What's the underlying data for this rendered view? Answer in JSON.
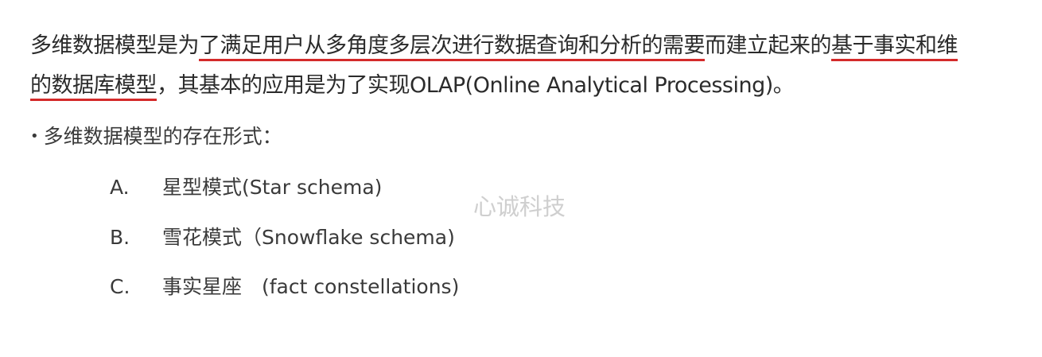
{
  "paragraph": {
    "line1_plain": "多维数据模型是为",
    "line1_underlined_a": "了满足用户从多角度多层次进行数据查询和分析的需要",
    "line1_middle": "而建立起来的",
    "line1_underlined_b": "基于事实和维",
    "line2_underlined": "的数据库模型",
    "line2_rest": "，其基本的应用是为了实现OLAP(Online Analytical Processing)。",
    "underline_color": "#d42a2a"
  },
  "section": {
    "bullet": "•",
    "heading": "多维数据模型的存在形式："
  },
  "options": [
    {
      "letter": "A.",
      "text": "星型模式(Star schema)"
    },
    {
      "letter": "B.",
      "text": "雪花模式（Snowflake schema)"
    },
    {
      "letter": "C.",
      "text": "事实星座　(fact constellations)"
    }
  ],
  "watermark": "心诚科技"
}
